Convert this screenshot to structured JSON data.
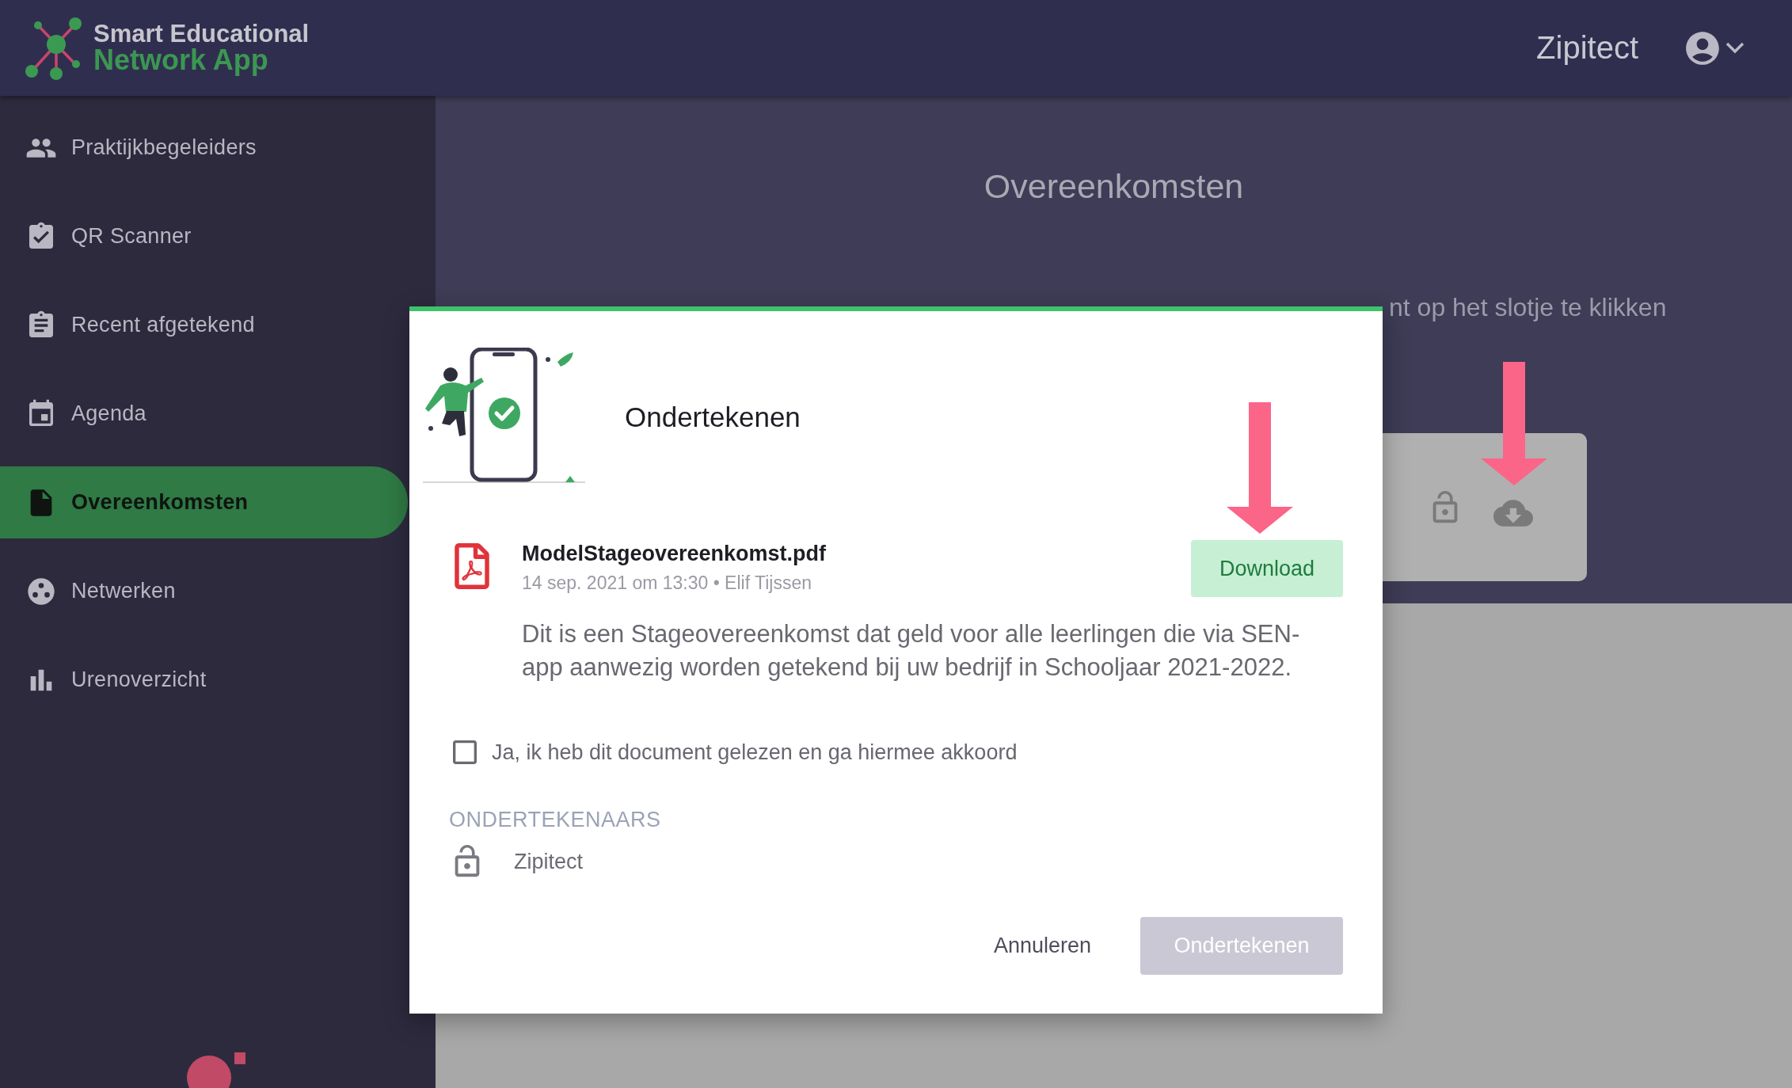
{
  "header": {
    "logo": {
      "line_1": "Smart Educational",
      "line_2": "Network App"
    },
    "user_name": "Zipitect"
  },
  "sidebar": {
    "items": [
      {
        "label": "Praktijkbegeleiders",
        "selected": false
      },
      {
        "label": "QR Scanner",
        "selected": false
      },
      {
        "label": "Recent afgetekend",
        "selected": false
      },
      {
        "label": "Agenda",
        "selected": false
      },
      {
        "label": "Overeenkomsten",
        "selected": true
      },
      {
        "label": "Netwerken",
        "selected": false
      },
      {
        "label": "Urenoverzicht",
        "selected": false
      }
    ]
  },
  "page": {
    "title": "Overeenkomsten",
    "description": "nt op het slotje te klikken"
  },
  "dialog": {
    "title": "Ondertekenen",
    "document": {
      "file_name": "ModelStageovereenkomst.pdf",
      "meta": "14 sep. 2021 om 13:30 • Elif Tijssen",
      "download_label": "Download"
    },
    "description": "Dit is een Stageovereenkomst dat geld voor alle leerlingen die via SEN-app aanwezig worden getekend bij uw bedrijf in Schooljaar 2021-2022.",
    "agreement": {
      "label": "Ja, ik heb dit document gelezen en ga hiermee akkoord",
      "checked": false
    },
    "signers_heading": "ONDERTEKENAARS",
    "signers": [
      {
        "name": "Zipitect"
      }
    ],
    "buttons": [
      {
        "label": "Annuleren",
        "kind": "text",
        "disabled": false
      },
      {
        "label": "Ondertekenen",
        "kind": "primary",
        "disabled": true
      }
    ]
  }
}
